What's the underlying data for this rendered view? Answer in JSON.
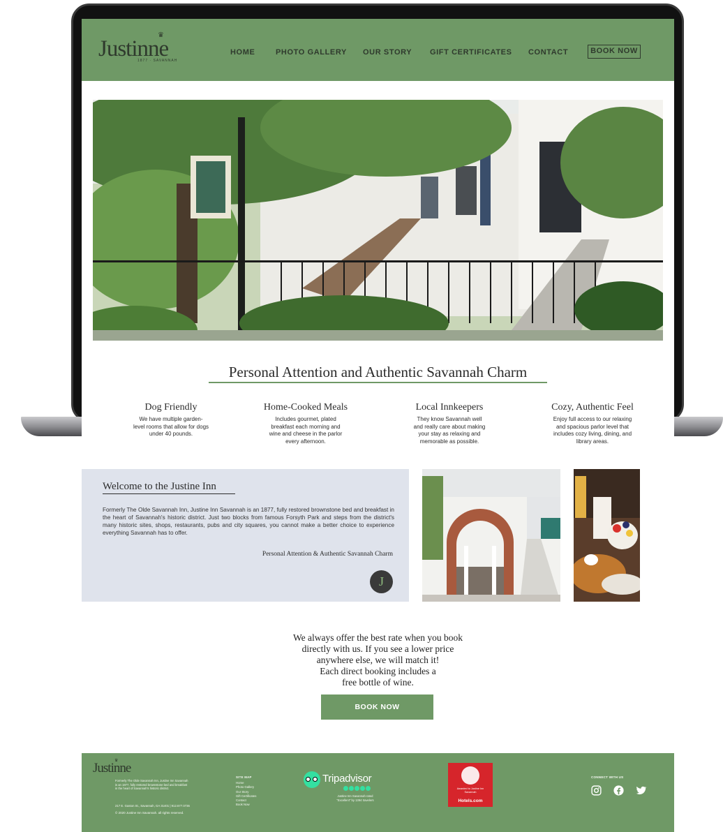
{
  "brand": {
    "name": "Justinne",
    "subtitle": "1877 · SAVANNAH"
  },
  "nav": {
    "items": [
      "HOME",
      "PHOTO GALLERY",
      "OUR STORY",
      "GIFT CERTIFICATES",
      "CONTACT"
    ],
    "book_now": "BOOK NOW"
  },
  "hero": {
    "image": "hero-inn-photo"
  },
  "tagline": "Personal Attention and Authentic Savannah Charm",
  "features": [
    {
      "title": "Dog Friendly",
      "lines": [
        "We have multiple garden-",
        "level rooms that allow for dogs",
        "under 40 pounds."
      ]
    },
    {
      "title": "Home-Cooked Meals",
      "lines": [
        "Includes gourmet, plated",
        "breakfast each morning and",
        "wine and cheese in the parlor",
        "every afternoon."
      ]
    },
    {
      "title": "Local Innkeepers",
      "lines": [
        "They know Savannah well",
        "and really care about making",
        "your stay as relaxing and",
        "memorable as possible."
      ]
    },
    {
      "title": "Cozy, Authentic Feel",
      "lines": [
        "Enjoy full access to our relaxing",
        "and spacious parlor level that",
        "includes cozy living, dining, and",
        "library areas."
      ]
    }
  ],
  "welcome": {
    "title": "Welcome to the Justine Inn",
    "body": "Formerly The Olde Savannah Inn, Justine Inn Savannah is an 1877, fully restored brownstone bed and breakfast in the heart of Savannah's historic district. Just two blocks from famous Forsyth Park and steps from the district's many historic sites, shops, restaurants, pubs and city squares, you cannot make a better choice to experience everything Savannah has to offer.",
    "tagline": "Personal Attention & Authentic Savannah Charm",
    "badge": "J"
  },
  "rate": {
    "lines": [
      "We always offer the best rate when you book",
      "directly with us. If you see a lower price",
      "anywhere else, we will match it!",
      "Each direct booking includes a",
      "free bottle of wine."
    ],
    "button": "BOOK NOW"
  },
  "footer": {
    "logo": "Justinne",
    "about_lines": [
      "Formerly The Olde Savannah Inn, Justine Inn Savannah",
      "is an 1877, fully restored brownstone bed and breakfast",
      "in the heart of Savannah's historic district."
    ],
    "address": "217 E. Gaston St., Savannah, GA 31401 | 912.677.0736",
    "copyright": "© 2020 Justine Inn Savannah. all rights reserved.",
    "sitemap_title": "SITE MAP",
    "sitemap": [
      "Home",
      "Photo Gallery",
      "Our Story",
      "Gift Certificates",
      "Contact",
      "Book Now"
    ],
    "tripadvisor": {
      "name": "Tripadvisor",
      "caption_lines": [
        "Justine Inn Savannah rated",
        "\"Excellent\" by 1394 travelers"
      ]
    },
    "award": {
      "lines": [
        "Awarded to Justine Inn",
        "Savannah"
      ],
      "brand": "Hotels.com"
    },
    "connect": "CONNECT WITH US",
    "social": [
      "instagram-icon",
      "facebook-icon",
      "twitter-icon"
    ]
  },
  "colors": {
    "brand_green": "#6f9966",
    "welcome_bg": "#dfe3ec",
    "award_red": "#d6252b",
    "tripadvisor_green": "#34e0a1"
  }
}
